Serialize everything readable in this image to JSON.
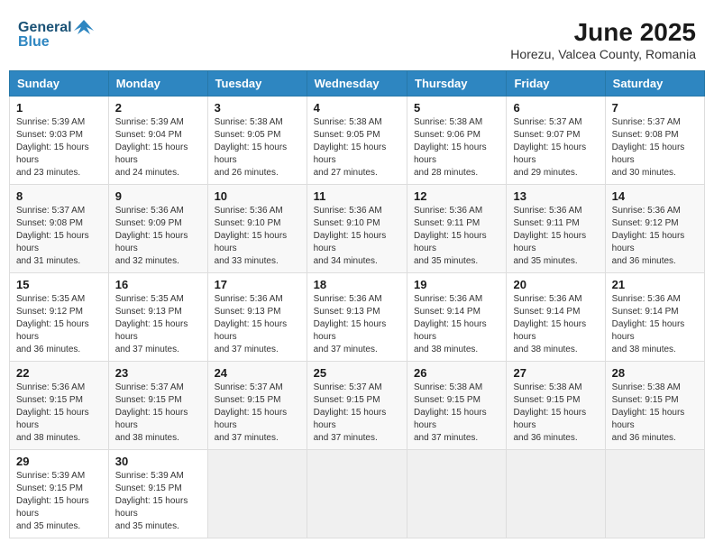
{
  "app": {
    "logo_line1": "General",
    "logo_line2": "Blue"
  },
  "header": {
    "title": "June 2025",
    "subtitle": "Horezu, Valcea County, Romania"
  },
  "calendar": {
    "columns": [
      "Sunday",
      "Monday",
      "Tuesday",
      "Wednesday",
      "Thursday",
      "Friday",
      "Saturday"
    ],
    "weeks": [
      [
        null,
        {
          "day": "2",
          "sunrise": "5:39 AM",
          "sunset": "9:04 PM",
          "daylight": "15 hours and 24 minutes."
        },
        {
          "day": "3",
          "sunrise": "5:38 AM",
          "sunset": "9:05 PM",
          "daylight": "15 hours and 26 minutes."
        },
        {
          "day": "4",
          "sunrise": "5:38 AM",
          "sunset": "9:05 PM",
          "daylight": "15 hours and 27 minutes."
        },
        {
          "day": "5",
          "sunrise": "5:38 AM",
          "sunset": "9:06 PM",
          "daylight": "15 hours and 28 minutes."
        },
        {
          "day": "6",
          "sunrise": "5:37 AM",
          "sunset": "9:07 PM",
          "daylight": "15 hours and 29 minutes."
        },
        {
          "day": "7",
          "sunrise": "5:37 AM",
          "sunset": "9:08 PM",
          "daylight": "15 hours and 30 minutes."
        }
      ],
      [
        {
          "day": "1",
          "sunrise": "5:39 AM",
          "sunset": "9:03 PM",
          "daylight": "15 hours and 23 minutes."
        },
        null,
        null,
        null,
        null,
        null,
        null
      ],
      [
        {
          "day": "8",
          "sunrise": "5:37 AM",
          "sunset": "9:08 PM",
          "daylight": "15 hours and 31 minutes."
        },
        {
          "day": "9",
          "sunrise": "5:36 AM",
          "sunset": "9:09 PM",
          "daylight": "15 hours and 32 minutes."
        },
        {
          "day": "10",
          "sunrise": "5:36 AM",
          "sunset": "9:10 PM",
          "daylight": "15 hours and 33 minutes."
        },
        {
          "day": "11",
          "sunrise": "5:36 AM",
          "sunset": "9:10 PM",
          "daylight": "15 hours and 34 minutes."
        },
        {
          "day": "12",
          "sunrise": "5:36 AM",
          "sunset": "9:11 PM",
          "daylight": "15 hours and 35 minutes."
        },
        {
          "day": "13",
          "sunrise": "5:36 AM",
          "sunset": "9:11 PM",
          "daylight": "15 hours and 35 minutes."
        },
        {
          "day": "14",
          "sunrise": "5:36 AM",
          "sunset": "9:12 PM",
          "daylight": "15 hours and 36 minutes."
        }
      ],
      [
        {
          "day": "15",
          "sunrise": "5:35 AM",
          "sunset": "9:12 PM",
          "daylight": "15 hours and 36 minutes."
        },
        {
          "day": "16",
          "sunrise": "5:35 AM",
          "sunset": "9:13 PM",
          "daylight": "15 hours and 37 minutes."
        },
        {
          "day": "17",
          "sunrise": "5:36 AM",
          "sunset": "9:13 PM",
          "daylight": "15 hours and 37 minutes."
        },
        {
          "day": "18",
          "sunrise": "5:36 AM",
          "sunset": "9:13 PM",
          "daylight": "15 hours and 37 minutes."
        },
        {
          "day": "19",
          "sunrise": "5:36 AM",
          "sunset": "9:14 PM",
          "daylight": "15 hours and 38 minutes."
        },
        {
          "day": "20",
          "sunrise": "5:36 AM",
          "sunset": "9:14 PM",
          "daylight": "15 hours and 38 minutes."
        },
        {
          "day": "21",
          "sunrise": "5:36 AM",
          "sunset": "9:14 PM",
          "daylight": "15 hours and 38 minutes."
        }
      ],
      [
        {
          "day": "22",
          "sunrise": "5:36 AM",
          "sunset": "9:15 PM",
          "daylight": "15 hours and 38 minutes."
        },
        {
          "day": "23",
          "sunrise": "5:37 AM",
          "sunset": "9:15 PM",
          "daylight": "15 hours and 38 minutes."
        },
        {
          "day": "24",
          "sunrise": "5:37 AM",
          "sunset": "9:15 PM",
          "daylight": "15 hours and 37 minutes."
        },
        {
          "day": "25",
          "sunrise": "5:37 AM",
          "sunset": "9:15 PM",
          "daylight": "15 hours and 37 minutes."
        },
        {
          "day": "26",
          "sunrise": "5:38 AM",
          "sunset": "9:15 PM",
          "daylight": "15 hours and 37 minutes."
        },
        {
          "day": "27",
          "sunrise": "5:38 AM",
          "sunset": "9:15 PM",
          "daylight": "15 hours and 36 minutes."
        },
        {
          "day": "28",
          "sunrise": "5:38 AM",
          "sunset": "9:15 PM",
          "daylight": "15 hours and 36 minutes."
        }
      ],
      [
        {
          "day": "29",
          "sunrise": "5:39 AM",
          "sunset": "9:15 PM",
          "daylight": "15 hours and 35 minutes."
        },
        {
          "day": "30",
          "sunrise": "5:39 AM",
          "sunset": "9:15 PM",
          "daylight": "15 hours and 35 minutes."
        },
        null,
        null,
        null,
        null,
        null
      ]
    ]
  }
}
